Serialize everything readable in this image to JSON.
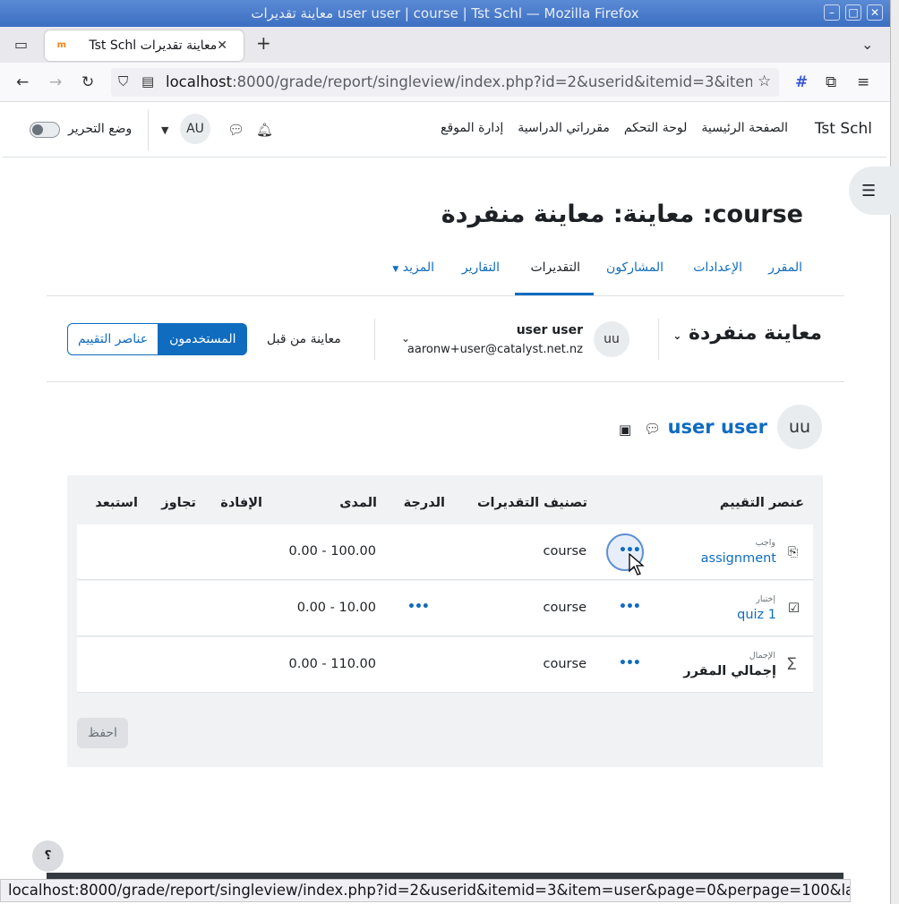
{
  "window": {
    "title": "user user | course | Tst Schl — Mozilla Firefox معاينة تقديرات",
    "title_display": "معاينة تقديرات user user | course | Tst Schl — Mozilla Firefox"
  },
  "browser": {
    "tab_title": "معاينة تقديرات Tst Schl",
    "url_host": "localhost",
    "url_rest": ":8000/grade/report/singleview/index.php?id=2&userid&itemid=3&item",
    "status_url": "localhost:8000/grade/report/singleview/index.php?id=2&userid&itemid=3&item=user&page=0&perpage=100&lang=ar#"
  },
  "header": {
    "site_name": "Tst Schl",
    "nav": [
      "الصفحة الرئيسية",
      "لوحة التحكم",
      "مقرراتي الدراسية",
      "إدارة الموقع"
    ],
    "avatar": "AU",
    "edit_mode_label": "وضع التحرير"
  },
  "page": {
    "title": "course: معاينة: معاينة منفردة"
  },
  "secondary_nav": {
    "items": [
      "المقرر",
      "الإعدادات",
      "المشاركون",
      "التقديرات",
      "التقارير",
      "المزيد"
    ],
    "active": "التقديرات"
  },
  "tertiary": {
    "title": "معاينة منفردة",
    "user_initials": "uu",
    "user_name": "user user",
    "user_email": "aaronw+user@catalyst.net.nz",
    "previous_view": "معاينة من قبل",
    "btn_users": "المستخدمون",
    "btn_items": "عناصر التقييم"
  },
  "user_heading": {
    "initials": "uu",
    "name": "user user"
  },
  "table": {
    "headers": {
      "item": "عنصر التقييم",
      "category": "تصنيف التقديرات",
      "grade": "الدرجة",
      "range": "المدى",
      "feedback": "الإفادة",
      "override": "تجاوز",
      "exclude": "استبعد"
    },
    "rows": [
      {
        "kind": "واجب",
        "name": "assignment",
        "category": "course",
        "range": "0.00 - 100.00"
      },
      {
        "kind": "إختبار",
        "name": "quiz 1",
        "category": "course",
        "range": "0.00 - 10.00"
      },
      {
        "kind": "الإجمال",
        "name": "إجمالي المقرر",
        "category": "course",
        "range": "0.00 - 110.00"
      }
    ],
    "save_label": "احفظ"
  },
  "help_label": "؟",
  "colors": {
    "accent": "#0f6cbf",
    "titlebar": "#3d6fc2"
  }
}
